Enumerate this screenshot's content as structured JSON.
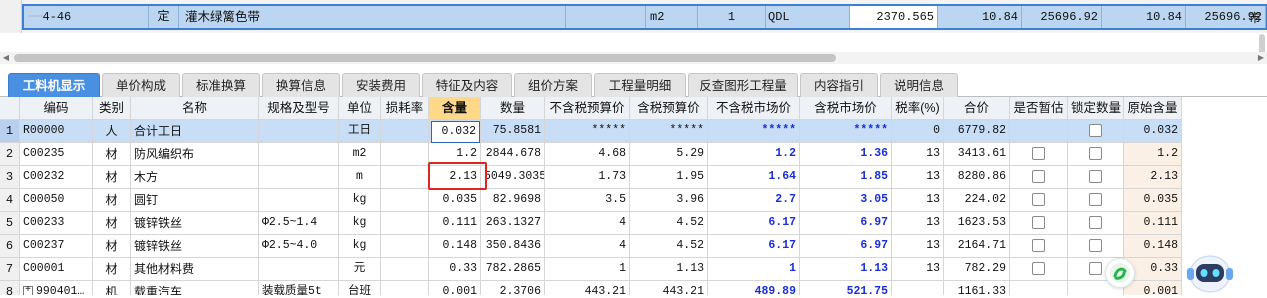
{
  "top_row": {
    "code": "4-46",
    "type": "定",
    "name": "灌木绿篱色带",
    "unit": "m2",
    "qty": "1",
    "expr": "QDL",
    "amount": "2370.565",
    "v1": "10.84",
    "v2": "25696.92",
    "v3": "10.84",
    "v4": "25696.92",
    "tail": "市"
  },
  "tabs": [
    {
      "label": "工料机显示",
      "active": true
    },
    {
      "label": "单价构成"
    },
    {
      "label": "标准换算"
    },
    {
      "label": "换算信息"
    },
    {
      "label": "安装费用"
    },
    {
      "label": "特征及内容"
    },
    {
      "label": "组价方案"
    },
    {
      "label": "工程量明细"
    },
    {
      "label": "反查图形工程量"
    },
    {
      "label": "内容指引"
    },
    {
      "label": "说明信息"
    }
  ],
  "columns": [
    "编码",
    "类别",
    "名称",
    "规格及型号",
    "单位",
    "损耗率",
    "含量",
    "数量",
    "不含税预算价",
    "含税预算价",
    "不含税市场价",
    "含税市场价",
    "税率(%)",
    "合价",
    "是否暂估",
    "锁定数量",
    "原始含量"
  ],
  "rows": [
    {
      "no": "1",
      "code": "R00000",
      "type": "人",
      "name": "合计工日",
      "spec": "",
      "unit": "工日",
      "loss": "",
      "content": "0.032",
      "qty": "75.8581",
      "p1": "*****",
      "p2": "*****",
      "p3": "*****",
      "p4": "*****",
      "tax": "0",
      "total": "6779.82",
      "est": false,
      "lock": true,
      "orig": "0.032"
    },
    {
      "no": "2",
      "code": "C00235",
      "type": "材",
      "name": "防风编织布",
      "spec": "",
      "unit": "m2",
      "loss": "",
      "content": "1.2",
      "qty": "2844.678",
      "p1": "4.68",
      "p2": "5.29",
      "p3": "1.2",
      "p4": "1.36",
      "tax": "13",
      "total": "3413.61",
      "est": true,
      "lock": true,
      "orig": "1.2"
    },
    {
      "no": "3",
      "code": "C00232",
      "type": "材",
      "name": "木方",
      "spec": "",
      "unit": "m",
      "loss": "",
      "content": "2.13",
      "qty": "5049.3035",
      "p1": "1.73",
      "p2": "1.95",
      "p3": "1.64",
      "p4": "1.85",
      "tax": "13",
      "total": "8280.86",
      "est": true,
      "lock": true,
      "orig": "2.13"
    },
    {
      "no": "4",
      "code": "C00050",
      "type": "材",
      "name": "圆钉",
      "spec": "",
      "unit": "kg",
      "loss": "",
      "content": "0.035",
      "qty": "82.9698",
      "p1": "3.5",
      "p2": "3.96",
      "p3": "2.7",
      "p4": "3.05",
      "tax": "13",
      "total": "224.02",
      "est": true,
      "lock": true,
      "orig": "0.035"
    },
    {
      "no": "5",
      "code": "C00233",
      "type": "材",
      "name": "镀锌铁丝",
      "spec": "Φ2.5~1.4",
      "unit": "kg",
      "loss": "",
      "content": "0.111",
      "qty": "263.1327",
      "p1": "4",
      "p2": "4.52",
      "p3": "6.17",
      "p4": "6.97",
      "tax": "13",
      "total": "1623.53",
      "est": true,
      "lock": true,
      "orig": "0.111"
    },
    {
      "no": "6",
      "code": "C00237",
      "type": "材",
      "name": "镀锌铁丝",
      "spec": "Φ2.5~4.0",
      "unit": "kg",
      "loss": "",
      "content": "0.148",
      "qty": "350.8436",
      "p1": "4",
      "p2": "4.52",
      "p3": "6.17",
      "p4": "6.97",
      "tax": "13",
      "total": "2164.71",
      "est": true,
      "lock": true,
      "orig": "0.148"
    },
    {
      "no": "7",
      "code": "C00001",
      "type": "材",
      "name": "其他材料费",
      "spec": "",
      "unit": "元",
      "loss": "",
      "content": "0.33",
      "qty": "782.2865",
      "p1": "1",
      "p2": "1.13",
      "p3": "1",
      "p4": "1.13",
      "tax": "13",
      "total": "782.29",
      "est": true,
      "lock": true,
      "orig": "0.33"
    },
    {
      "no": "8",
      "code": "990401…",
      "type": "机",
      "name": "载重汽车",
      "spec": "装载质量5t",
      "unit": "台班",
      "loss": "",
      "content": "0.001",
      "qty": "2.3706",
      "p1": "443.21",
      "p2": "443.21",
      "p3": "489.89",
      "p4": "521.75",
      "tax": "",
      "total": "1161.33",
      "est": false,
      "lock": false,
      "orig": "0.001"
    }
  ],
  "colors": {
    "accent": "#4a90e2",
    "highlight_header": "#ffd88a",
    "selected_row": "#c8def6",
    "market_price": "#1a2fd6",
    "annotation": "#e0261c"
  }
}
